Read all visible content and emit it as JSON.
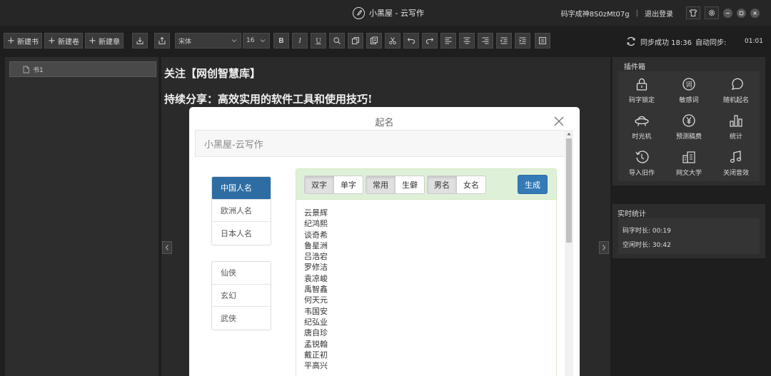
{
  "titlebar": {
    "app_title": "小黑屋 - 云写作",
    "user_id": "码字成神8S0zMt07g",
    "logout": "退出登录"
  },
  "toolbar": {
    "new_book": "新建书",
    "new_volume": "新建卷",
    "new_chapter": "新建章",
    "font_family": "宋体",
    "font_size": "16",
    "bold": "B",
    "italic": "I",
    "underline": "U",
    "sync_status": "同步成功 18:36",
    "auto_sync": "自动同步:",
    "timer": "01:01"
  },
  "left_panel": {
    "book_item": "书1"
  },
  "editor": {
    "line1": "关注【网创智慧库】",
    "line2": "持续分享：高效实用的软件工具和使用技巧!"
  },
  "plugins": {
    "title": "插件箱",
    "items": [
      {
        "label": "码字锁定",
        "icon": "lock-icon"
      },
      {
        "label": "敏感词",
        "icon": "sensitive-word-icon"
      },
      {
        "label": "随机起名",
        "icon": "random-name-icon"
      },
      {
        "label": "时光机",
        "icon": "ufo-icon"
      },
      {
        "label": "预测稿费",
        "icon": "yen-coin-icon"
      },
      {
        "label": "统计",
        "icon": "bar-chart-icon"
      },
      {
        "label": "导入旧作",
        "icon": "history-import-icon"
      },
      {
        "label": "网文大学",
        "icon": "building-icon"
      },
      {
        "label": "关闭音效",
        "icon": "music-note-icon"
      }
    ]
  },
  "stats": {
    "title": "实时统计",
    "typing_time": "码字时长: 00:19",
    "idle_time": "空闲时长: 30:42"
  },
  "modal": {
    "title": "起名",
    "subtitle": "小黑屋-云写作",
    "categories_a": [
      "中国人名",
      "欧洲人名",
      "日本人名"
    ],
    "categories_b": [
      "仙侠",
      "玄幻",
      "武侠"
    ],
    "length_options": [
      "双字",
      "单字"
    ],
    "rarity_options": [
      "常用",
      "生僻"
    ],
    "gender_options": [
      "男名",
      "女名"
    ],
    "generate": "生成",
    "names": [
      "云景辉",
      "纪鸿熙",
      "谈奇希",
      "鲁星洲",
      "吕浩宕",
      "罗修洁",
      "袁凉峻",
      "禹智鑫",
      "何天元",
      "韦国安",
      "纪弘业",
      "唐自珍",
      "孟锐翰",
      "戴正初",
      "平高兴"
    ]
  },
  "colors": {
    "accent_blue": "#337ab7",
    "panel_green": "#dff0d8",
    "app_bg": "#1e1e1e"
  }
}
